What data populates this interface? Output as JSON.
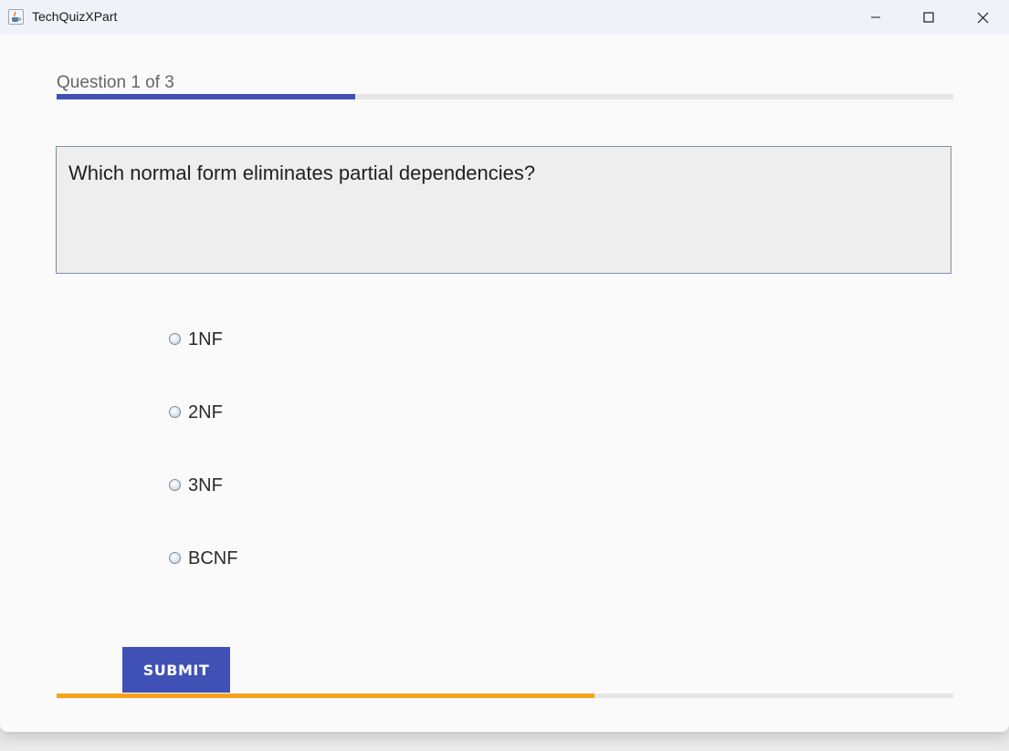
{
  "window": {
    "title": "TechQuizXPart",
    "icon": "java-cup-icon"
  },
  "window_controls": {
    "minimize_icon": "minimize-icon",
    "maximize_icon": "maximize-icon",
    "close_icon": "close-icon"
  },
  "progress": {
    "label": "Question 1 of 3",
    "current": 1,
    "total": 3,
    "fraction": 0.333,
    "color": "#3f51b5"
  },
  "question": {
    "text": "Which normal form eliminates partial dependencies?"
  },
  "options": [
    {
      "label": "1NF",
      "selected": false
    },
    {
      "label": "2NF",
      "selected": false
    },
    {
      "label": "3NF",
      "selected": false
    },
    {
      "label": "BCNF",
      "selected": false
    }
  ],
  "submit": {
    "label": "SUBMIT",
    "color": "#3f51b5"
  },
  "timer": {
    "fraction_remaining": 0.6,
    "color": "#f7a21b"
  }
}
